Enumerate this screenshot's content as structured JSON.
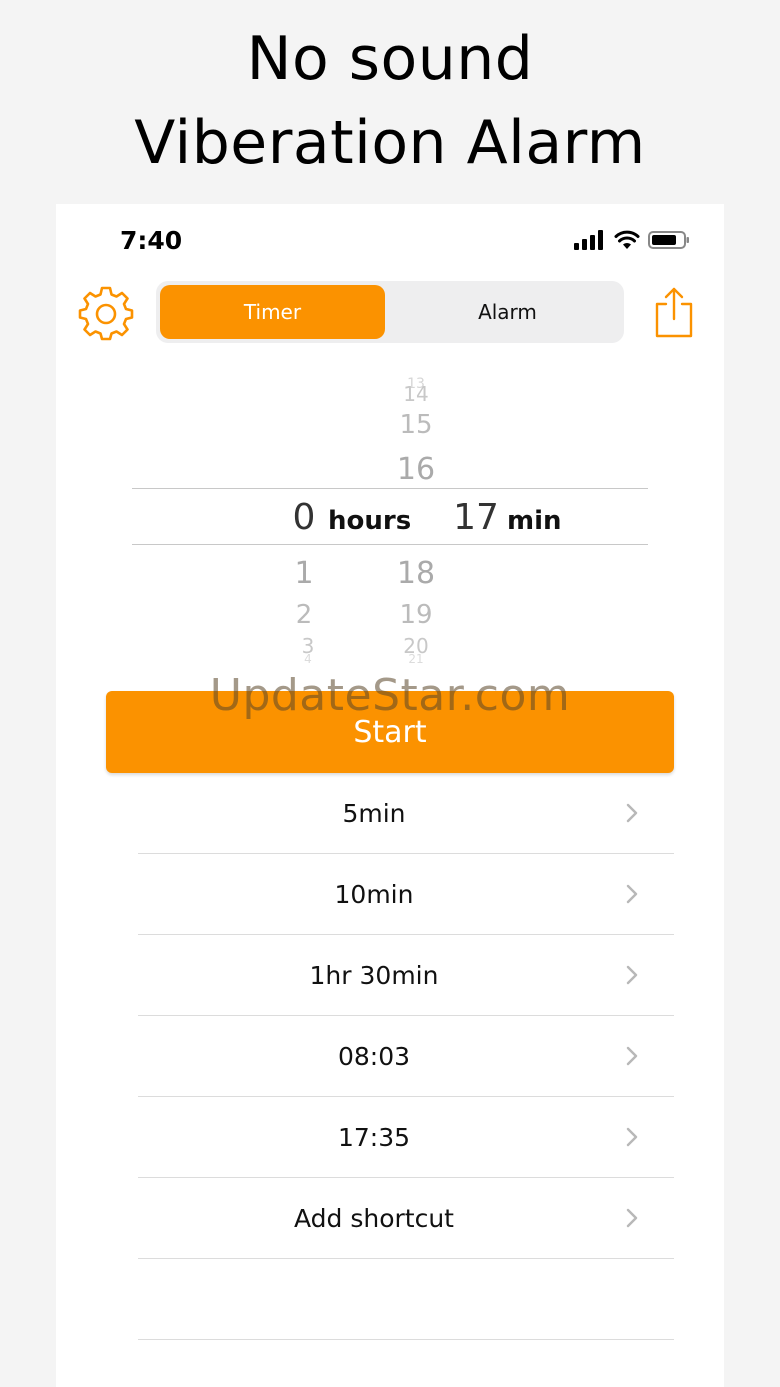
{
  "headline": {
    "line1": "No sound",
    "line2": "Viberation Alarm"
  },
  "status_bar": {
    "time": "7:40"
  },
  "segment": {
    "timer_label": "Timer",
    "alarm_label": "Alarm",
    "selected": "Timer"
  },
  "picker": {
    "hours_above": [],
    "hours_selected": "0",
    "hours_unit": "hours",
    "hours_below": [
      "1",
      "2",
      "3",
      "4"
    ],
    "minutes_above": [
      "13",
      "14",
      "15",
      "16"
    ],
    "minutes_selected": "17",
    "minutes_unit": "min",
    "minutes_below": [
      "18",
      "19",
      "20",
      "21"
    ]
  },
  "start_label": "Start",
  "watermark": "UpdateStar.com",
  "shortcuts": [
    {
      "label": "5min"
    },
    {
      "label": "10min"
    },
    {
      "label": "1hr 30min"
    },
    {
      "label": "08:03"
    },
    {
      "label": "17:35"
    },
    {
      "label": "Add shortcut"
    }
  ],
  "colors": {
    "accent": "#fb9200",
    "background": "#f4f4f4"
  },
  "icons": [
    "gear-icon",
    "share-icon",
    "chevron-right-icon",
    "signal-icon",
    "wifi-icon",
    "battery-icon"
  ]
}
